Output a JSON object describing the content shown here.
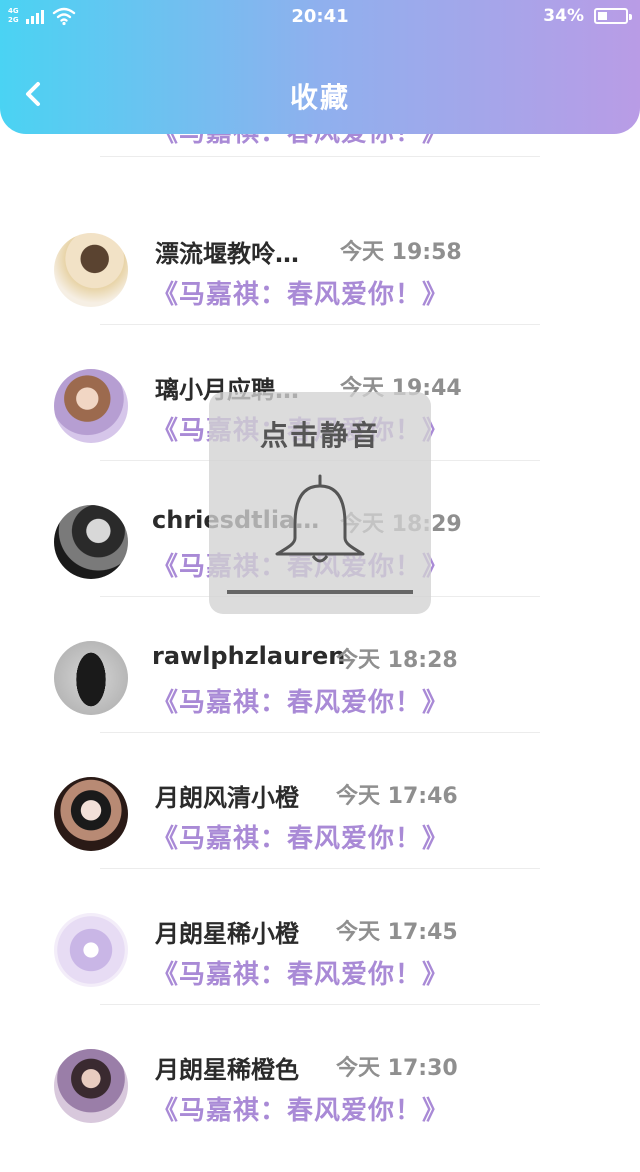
{
  "status_bar": {
    "net_top": "4G",
    "net_bottom": "2G",
    "time": "20:41",
    "battery": "34%",
    "battery_level": 0.34,
    "signal_icon": "signal-bars-icon",
    "wifi_icon": "wifi-icon",
    "battery_icon": "battery-icon"
  },
  "header": {
    "title": "收藏",
    "back_icon": "chevron-left-icon",
    "gradient": [
      "#4ad3f3",
      "#b99ce6"
    ]
  },
  "colors": {
    "accent_purple": "#a98ad6",
    "name_text": "#2b2b2b",
    "time_text": "#8f8f8f"
  },
  "items": [
    {
      "name": "",
      "time": "",
      "subtitle": "《马嘉祺：春风爱你！》"
    },
    {
      "name": "漂流堰教呤…",
      "time": "今天 19:58",
      "subtitle": "《马嘉祺：春风爱你！》"
    },
    {
      "name": "璃小月应聘…",
      "time": "今天 19:44",
      "subtitle": "《马嘉祺：春风爱你！》"
    },
    {
      "name": "chriesdtlia…",
      "time": "今天 18:29",
      "subtitle": "《马嘉祺：春风爱你！》"
    },
    {
      "name": "rawlphzlauren",
      "time": "今天 18:28",
      "subtitle": "《马嘉祺：春风爱你！》"
    },
    {
      "name": "月朗风清小橙",
      "time": "今天 17:46",
      "subtitle": "《马嘉祺：春风爱你！》"
    },
    {
      "name": "月朗星稀小橙",
      "time": "今天 17:45",
      "subtitle": "《马嘉祺：春风爱你！》"
    },
    {
      "name": "月朗星稀橙色",
      "time": "今天 17:30",
      "subtitle": "《马嘉祺：春风爱你！》"
    }
  ],
  "toast": {
    "text": "点击静音",
    "icon": "bell-icon"
  }
}
